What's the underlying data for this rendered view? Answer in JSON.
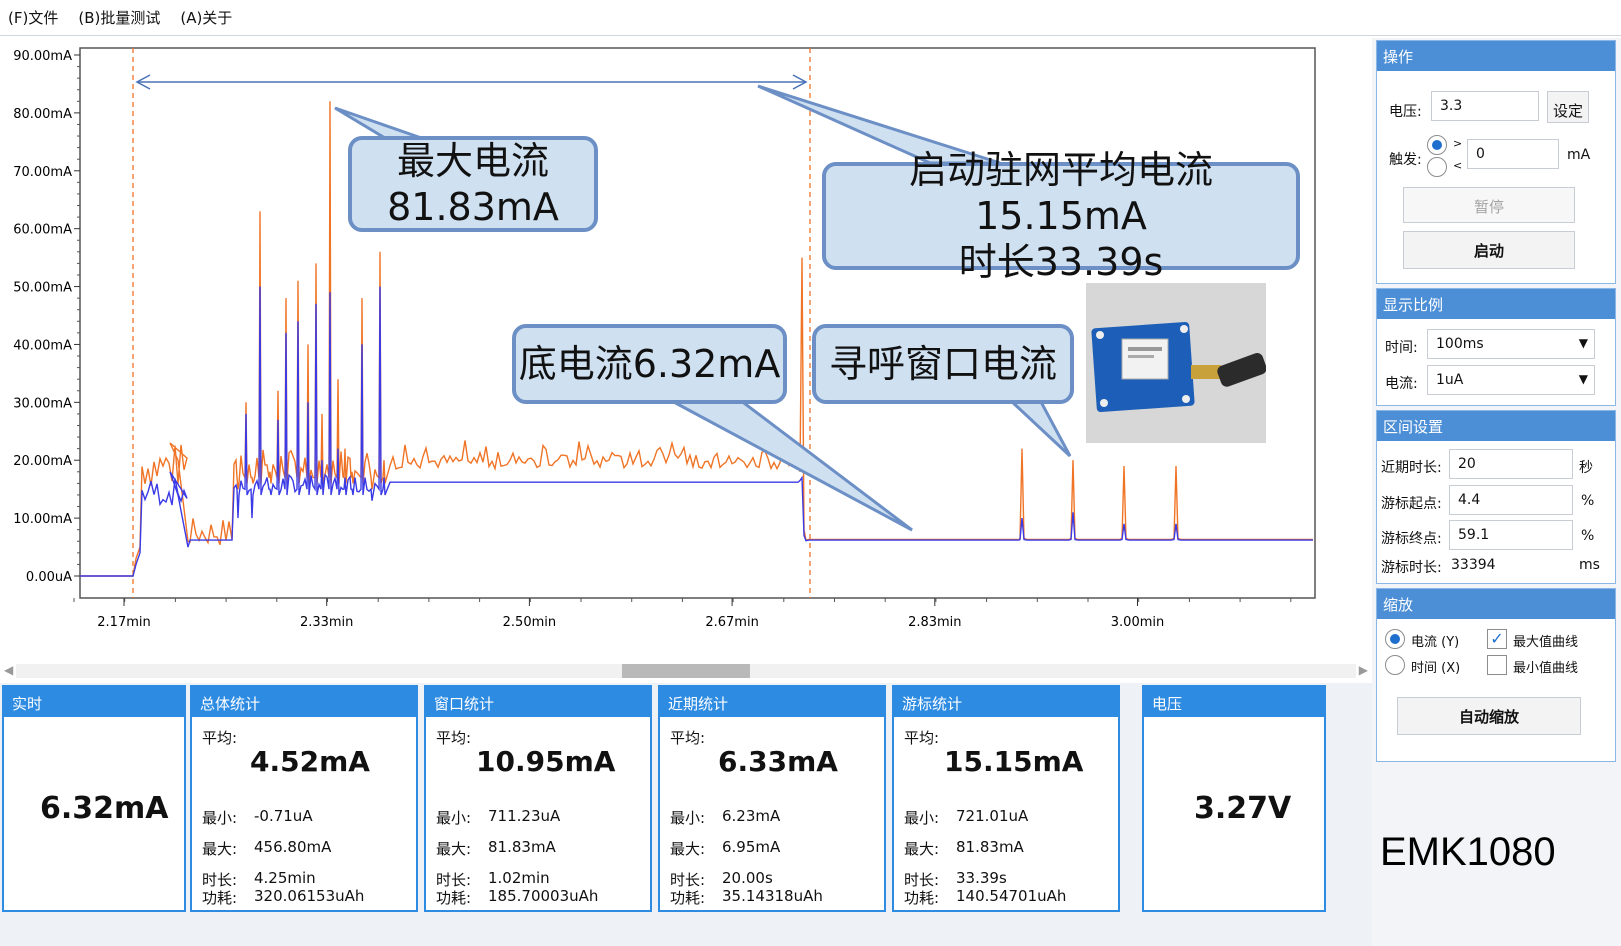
{
  "menu": [
    "(F)文件",
    "(B)批量测试",
    "(A)关于"
  ],
  "chart": {
    "y_ticks": [
      "90.00mA",
      "80.00mA",
      "70.00mA",
      "60.00mA",
      "50.00mA",
      "40.00mA",
      "30.00mA",
      "20.00mA",
      "10.00mA",
      "0.00uA"
    ],
    "x_ticks": [
      "2.17min",
      "2.33min",
      "2.50min",
      "2.67min",
      "2.83min",
      "3.00min"
    ]
  },
  "chart_data": {
    "type": "line",
    "x": [
      "2.17min",
      "2.33min",
      "2.50min",
      "2.67min",
      "2.83min",
      "3.00min"
    ],
    "ylim": [
      0,
      90
    ],
    "y_unit": "mA",
    "series": [
      {
        "name": "最大值曲线",
        "color": "#f07426"
      },
      {
        "name": "",
        "color": "#3a3ae6"
      }
    ],
    "annotations": [
      "最大电流 81.83mA",
      "启动驻网平均电流15.15mA 时长33.39s",
      "底电流6.32mA",
      "寻呼窗口电流"
    ]
  },
  "callouts": {
    "max_title": "最大电流",
    "max_value": "81.83mA",
    "avg_line1": "启动驻网平均电流15.15mA",
    "avg_line2": "时长33.39s",
    "base": "底电流6.32mA",
    "paging": "寻呼窗口电流"
  },
  "ops": {
    "title": "操作",
    "voltage_label": "电压:",
    "voltage_value": "3.3",
    "set_button": "设定",
    "trigger_label": "触发:",
    "trigger_gt": ">",
    "trigger_lt": "<",
    "trigger_value": "0",
    "trigger_unit": "mA",
    "pause_button": "暂停",
    "start_button": "启动"
  },
  "scale": {
    "title": "显示比例",
    "time_label": "时间:",
    "time_value": "100ms",
    "current_label": "电流:",
    "current_value": "1uA"
  },
  "range": {
    "title": "区间设置",
    "recent_label": "近期时长:",
    "recent_value": "20",
    "recent_unit": "秒",
    "start_label": "游标起点:",
    "start_value": "4.4",
    "start_unit": "%",
    "end_label": "游标终点:",
    "end_value": "59.1",
    "end_unit": "%",
    "dur_label": "游标时长:",
    "dur_value": "33394",
    "dur_unit": "ms"
  },
  "zoom": {
    "title": "缩放",
    "current_opt": "电流 (Y)",
    "time_opt": "时间 (X)",
    "max_curve": "最大值曲线",
    "min_curve": "最小值曲线",
    "auto_button": "自动缩放"
  },
  "panels": {
    "realtime": {
      "title": "实时",
      "value": "6.32mA"
    },
    "total": {
      "title": "总体统计",
      "avg_label": "平均:",
      "avg": "4.52mA",
      "min_label": "最小:",
      "min": "-0.71uA",
      "max_label": "最大:",
      "max": "456.80mA",
      "dur_label": "时长:",
      "dur": "4.25min",
      "energy_label": "功耗:",
      "energy": "320.06153uAh"
    },
    "window": {
      "title": "窗口统计",
      "avg_label": "平均:",
      "avg": "10.95mA",
      "min_label": "最小:",
      "min": "711.23uA",
      "max_label": "最大:",
      "max": "81.83mA",
      "dur_label": "时长:",
      "dur": "1.02min",
      "energy_label": "功耗:",
      "energy": "185.70003uAh"
    },
    "recent": {
      "title": "近期统计",
      "avg_label": "平均:",
      "avg": "6.33mA",
      "min_label": "最小:",
      "min": "6.23mA",
      "max_label": "最大:",
      "max": "6.95mA",
      "dur_label": "时长:",
      "dur": "20.00s",
      "energy_label": "功耗:",
      "energy": "35.14318uAh"
    },
    "cursor": {
      "title": "游标统计",
      "avg_label": "平均:",
      "avg": "15.15mA",
      "min_label": "最小:",
      "min": "721.01uA",
      "max_label": "最大:",
      "max": "81.83mA",
      "dur_label": "时长:",
      "dur": "33.39s",
      "energy_label": "功耗:",
      "energy": "140.54701uAh"
    },
    "voltage": {
      "title": "电压",
      "value": "3.27V"
    }
  },
  "brand": "EMK1080"
}
